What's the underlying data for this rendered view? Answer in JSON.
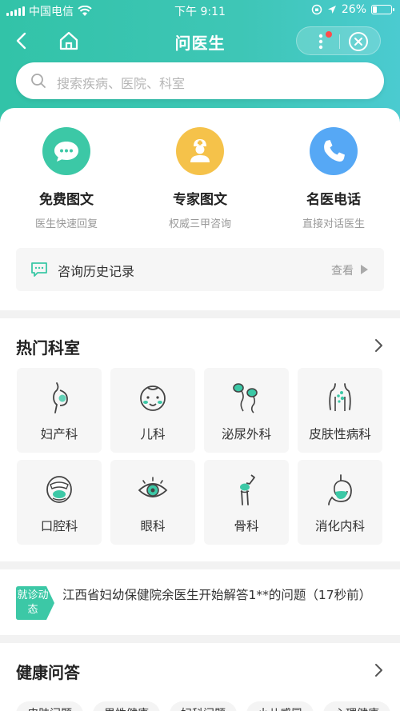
{
  "status_bar": {
    "carrier": "中国电信",
    "time": "下午 9:11",
    "battery_text": "26%",
    "battery_level": 0.26
  },
  "nav": {
    "title": "问医生"
  },
  "search": {
    "placeholder": "搜索疾病、医院、科室"
  },
  "services": [
    {
      "title": "免费图文",
      "subtitle": "医生快速回复",
      "icon": "chat-bubble-icon",
      "color": "#3cc8a6"
    },
    {
      "title": "专家图文",
      "subtitle": "权威三甲咨询",
      "icon": "doctor-icon",
      "color": "#f5c24a"
    },
    {
      "title": "名医电话",
      "subtitle": "直接对话医生",
      "icon": "phone-icon",
      "color": "#56a8f5"
    }
  ],
  "history": {
    "label": "咨询历史记录",
    "action": "查看"
  },
  "departments": {
    "title": "热门科室",
    "items": [
      {
        "name": "妇产科",
        "icon": "pregnancy-icon"
      },
      {
        "name": "儿科",
        "icon": "baby-face-icon"
      },
      {
        "name": "泌尿外科",
        "icon": "sperm-icon"
      },
      {
        "name": "皮肤性病科",
        "icon": "skin-body-icon"
      },
      {
        "name": "口腔科",
        "icon": "mouth-icon"
      },
      {
        "name": "眼科",
        "icon": "eye-icon"
      },
      {
        "name": "骨科",
        "icon": "bone-joint-icon"
      },
      {
        "name": "消化内科",
        "icon": "stomach-icon"
      }
    ]
  },
  "news": {
    "tag": "就诊动态",
    "text": "江西省妇幼保健院余医生开始解答1**的问题（17秒前）"
  },
  "health_qa": {
    "title": "健康问答",
    "chips": [
      "皮肤问题",
      "男性健康",
      "妇科问题",
      "小儿感冒",
      "心理健康"
    ]
  },
  "colors": {
    "primary": "#35c4ac",
    "accent_green": "#3cc8a6",
    "accent_yellow": "#f5c24a",
    "accent_blue": "#56a8f5"
  }
}
